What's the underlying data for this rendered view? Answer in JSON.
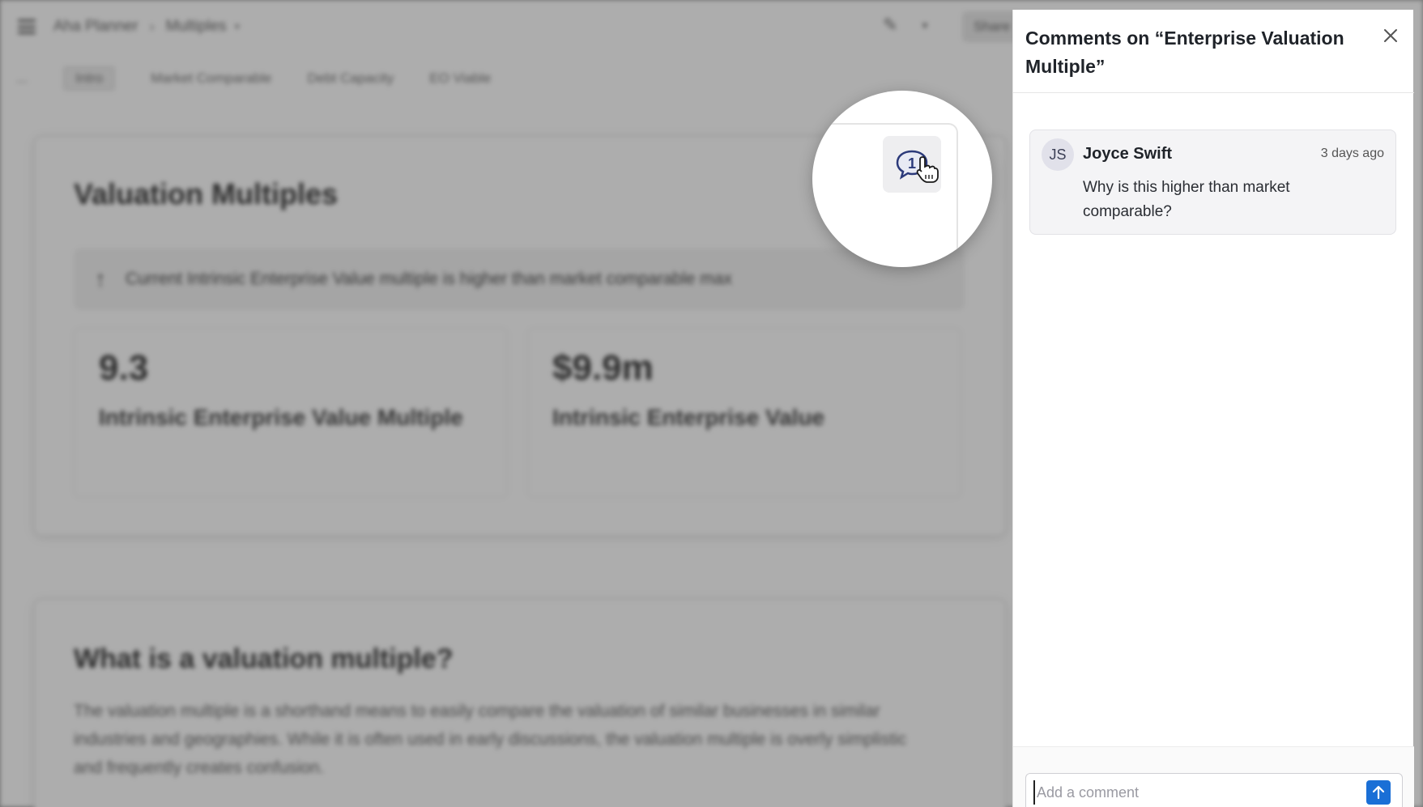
{
  "app": {
    "breadcrumb": [
      "Aha Planner",
      "Multiples"
    ],
    "share_label": "Share",
    "tabs": [
      "...",
      "Intro",
      "Market Comparable",
      "Debt Capacity",
      "EO Viable"
    ],
    "active_tab": "Intro"
  },
  "main_card": {
    "title": "Valuation Multiples",
    "alert": "Current Intrinsic Enterprise Value multiple is higher than market comparable max",
    "metrics": [
      {
        "value": "9.3",
        "label": "Intrinsic Enterprise Value Multiple"
      },
      {
        "value": "$9.9m",
        "label": "Intrinsic Enterprise Value"
      }
    ]
  },
  "second_card": {
    "title": "What is a valuation multiple?",
    "body": "The valuation multiple is a shorthand means to easily compare the valuation of similar businesses in similar industries and geographies. While it is often used in early discussions, the valuation multiple is overly simplistic and frequently creates confusion."
  },
  "magnifier": {
    "comment_count": "1"
  },
  "comments_panel": {
    "title": "Comments on “Enterprise Valuation Multiple”",
    "comments": [
      {
        "initials": "JS",
        "author": "Joyce Swift",
        "time": "3 days ago",
        "text": "Why is this higher than market comparable?"
      }
    ],
    "input_placeholder": "Add a comment"
  },
  "colors": {
    "accent": "#1a6fd6",
    "panel_bg": "#ffffff",
    "comment_bg": "#f4f4f6",
    "overlay": "#5a5a5a"
  },
  "icons": {
    "menu": "hamburger-icon",
    "close": "close-icon",
    "send": "arrow-up-icon",
    "comment_badge": "comment-bubble-icon",
    "cursor": "hand-pointer-icon"
  }
}
